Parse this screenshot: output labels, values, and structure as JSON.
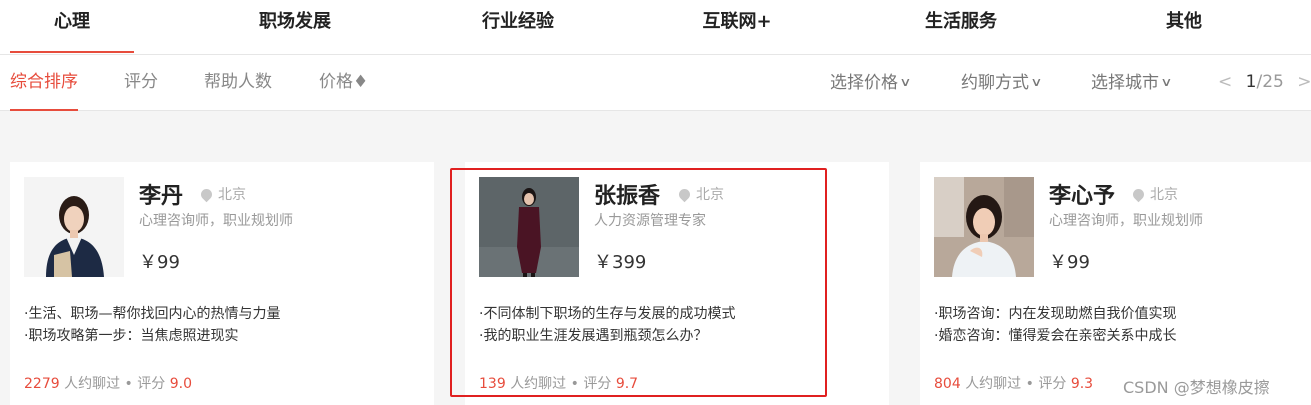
{
  "top_tabs": [
    "心理",
    "职场发展",
    "行业经验",
    "互联网+",
    "生活服务",
    "其他"
  ],
  "sort_options": [
    "综合排序",
    "评分",
    "帮助人数",
    "价格♦"
  ],
  "filters": [
    "选择价格",
    "约聊方式",
    "选择城市"
  ],
  "pager": {
    "prev": "<",
    "current": "1",
    "total": "/25",
    "next": ">"
  },
  "experts": [
    {
      "name": "李丹",
      "location": "北京",
      "title": "心理咨询师，职业规划师",
      "price": "￥99",
      "desc_lines": [
        "·生活、职场—帮你找回内心的热情与力量",
        "·职场攻略第一步：当焦虑照进现实"
      ],
      "chat_count": "2279",
      "chat_text": "人约聊过 • 评分",
      "rating": "9.0"
    },
    {
      "name": "张振香",
      "location": "北京",
      "title": "人力资源管理专家",
      "price": "￥399",
      "desc_lines": [
        "·不同体制下职场的生存与发展的成功模式",
        "·我的职业生涯发展遇到瓶颈怎么办？"
      ],
      "chat_count": "139",
      "chat_text": "人约聊过 • 评分",
      "rating": "9.7"
    },
    {
      "name": "李心予",
      "location": "北京",
      "title": "心理咨询师，职业规划师",
      "price": "￥99",
      "desc_lines": [
        "·职场咨询：内在发现助燃自我价值实现",
        "·婚恋咨询：懂得爱会在亲密关系中成长"
      ],
      "chat_count": "804",
      "chat_text": "人约聊过 • 评分",
      "rating": "9.3"
    }
  ],
  "watermark": "CSDN @梦想橡皮擦",
  "colors": {
    "accent": "#e74c3c",
    "highlight_border": "#e02020"
  }
}
